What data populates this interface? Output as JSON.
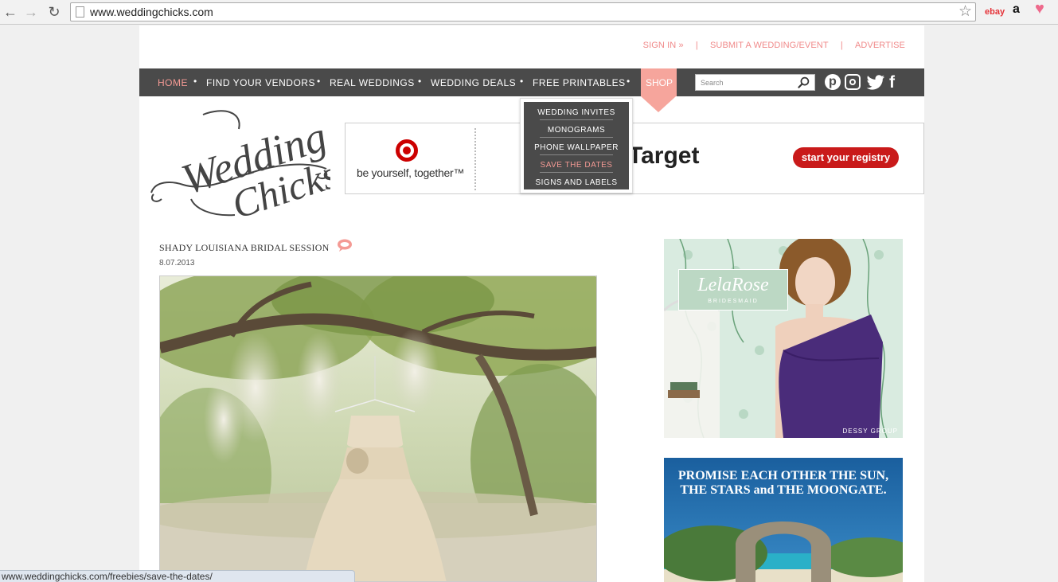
{
  "browser": {
    "url": "www.weddingchicks.com",
    "status_url": "www.weddingchicks.com/freebies/save-the-dates/",
    "ext_ebay": "ebay",
    "ext_amazon": "a"
  },
  "toplinks": {
    "sign_in": "SIGN IN »",
    "sep": "|",
    "submit": "SUBMIT A WEDDING/EVENT",
    "advertise": "ADVERTISE"
  },
  "nav": {
    "items": [
      "HOME",
      "FIND YOUR VENDORS",
      "REAL WEDDINGS",
      "WEDDING DEALS",
      "FREE PRINTABLES",
      "SHOP"
    ],
    "bullet": "•",
    "search_placeholder": "Search"
  },
  "dropdown": {
    "items": [
      "WEDDING INVITES",
      "MONOGRAMS",
      "PHONE WALLPAPER",
      "SAVE THE DATES",
      "SIGNS AND LABELS"
    ]
  },
  "ad": {
    "tagline": "be yourself, together™",
    "brand": "Target",
    "registry": "start your registry"
  },
  "post": {
    "title": "SHADY LOUISIANA BRIDAL SESSION",
    "date": "8.07.2013"
  },
  "side_ads": {
    "lela_name": "LelaRose",
    "lela_sub": "BRIDESMAID",
    "dessy": "DESSY GROUP",
    "promise_line1": "PROMISE EACH OTHER THE SUN,",
    "promise_line2": "THE STARS and THE MOONGATE."
  },
  "colors": {
    "accent_pink": "#f49a94",
    "nav_bg": "#4a4a4a",
    "target_red": "#cc0000"
  }
}
